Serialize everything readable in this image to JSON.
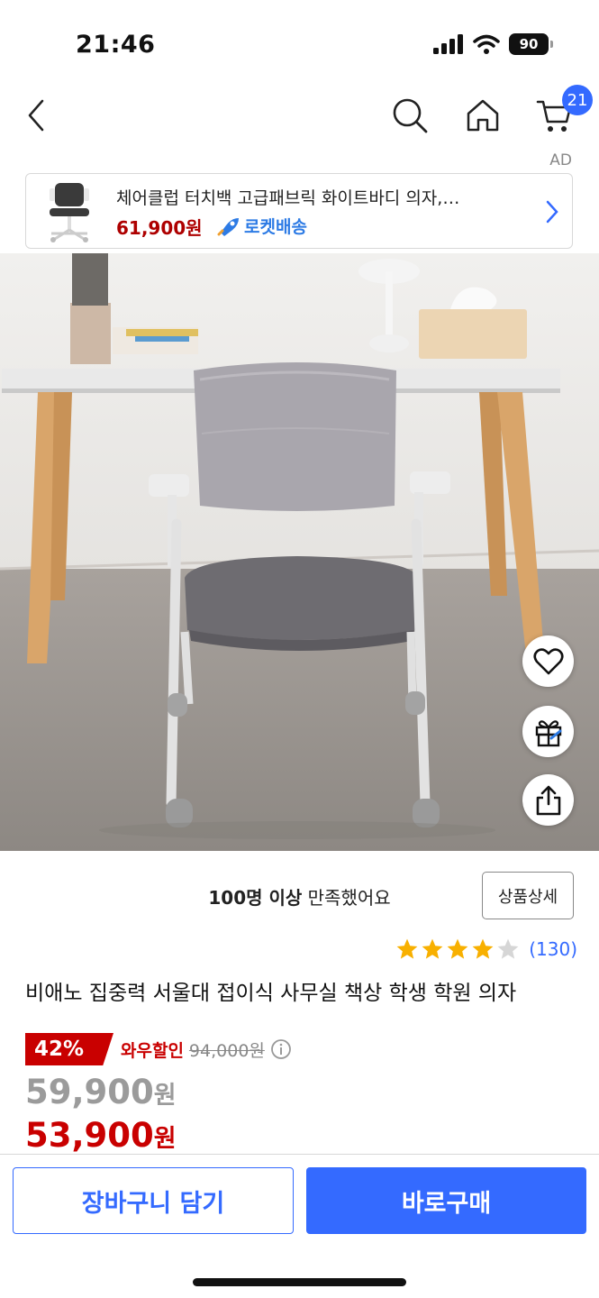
{
  "status_bar": {
    "time": "21:46",
    "battery": "90"
  },
  "nav": {
    "cart_count": "21"
  },
  "ad": {
    "label": "AD",
    "title": "체어클럽 터치백 고급패브릭 화이트바디 의자,…",
    "price": "61,900원",
    "delivery": "로켓배송"
  },
  "product": {
    "satisfaction_bold": "100명 이상",
    "satisfaction_rest": " 만족했어요",
    "detail_button": "상품상세",
    "rating": 4,
    "rating_max": 5,
    "review_count": "(130)",
    "title": "비애노 집중력 서울대 접이식 사무실 책상 학생 학원 의자"
  },
  "price": {
    "discount": "42%",
    "wow_label": "와우할인",
    "original": "94,000원",
    "regular_value": "59,900",
    "regular_unit": "원",
    "sale_value": "53,900",
    "sale_unit": "원"
  },
  "actions": {
    "add_to_cart": "장바구니 담기",
    "buy_now": "바로구매"
  },
  "colors": {
    "accent": "#346aff",
    "sale": "#c90000",
    "star": "#f8b000",
    "rocket": "#2d7be5"
  },
  "icons": [
    "back-icon",
    "search-icon",
    "home-icon",
    "cart-icon",
    "heart-icon",
    "gift-icon",
    "share-icon",
    "info-icon",
    "chevron-right-icon",
    "star-icon"
  ]
}
